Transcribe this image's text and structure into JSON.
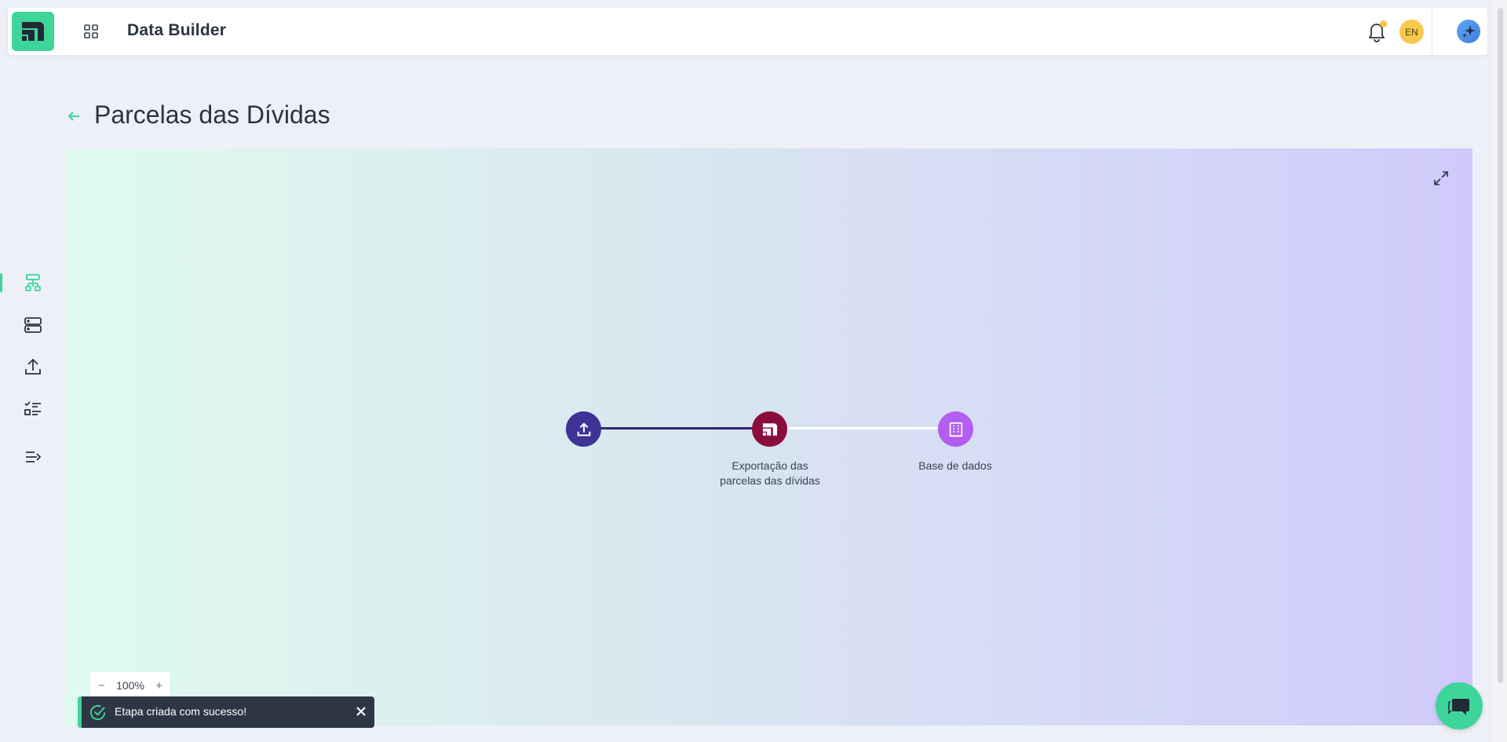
{
  "header": {
    "app_title": "Data Builder",
    "language": "EN",
    "logo_icon": "logo-icon",
    "apps_icon": "grid-icon",
    "notification_icon": "bell-icon",
    "assistant_icon": "sparkle-icon"
  },
  "sidebar": {
    "items": [
      {
        "name": "pipelines",
        "icon": "flow-icon",
        "active": true
      },
      {
        "name": "databases",
        "icon": "server-icon",
        "active": false
      },
      {
        "name": "upload",
        "icon": "upload-icon",
        "active": false
      },
      {
        "name": "checklist",
        "icon": "checklist-icon",
        "active": false
      },
      {
        "name": "expand",
        "icon": "collapse-arrow-icon",
        "active": false
      }
    ]
  },
  "page": {
    "title": "Parcelas das Dívidas"
  },
  "canvas": {
    "nodes": [
      {
        "label": "",
        "icon": "upload-icon",
        "color": "#3d3296"
      },
      {
        "label": "Exportação das parcelas das dívidas",
        "icon": "logo-icon",
        "color": "#8a0e3c"
      },
      {
        "label": "Base de dados",
        "icon": "database-icon",
        "color": "#b25ef0"
      }
    ],
    "edges": [
      {
        "from": 0,
        "to": 1,
        "color": "#2d2677"
      },
      {
        "from": 1,
        "to": 2,
        "color": "#ffffff"
      }
    ],
    "zoom": {
      "minus": "−",
      "level": "100%",
      "plus": "+"
    }
  },
  "toast": {
    "message": "Etapa criada com sucesso!"
  },
  "colors": {
    "accent": "#3ed59a",
    "toast_bg": "#2e3646"
  }
}
